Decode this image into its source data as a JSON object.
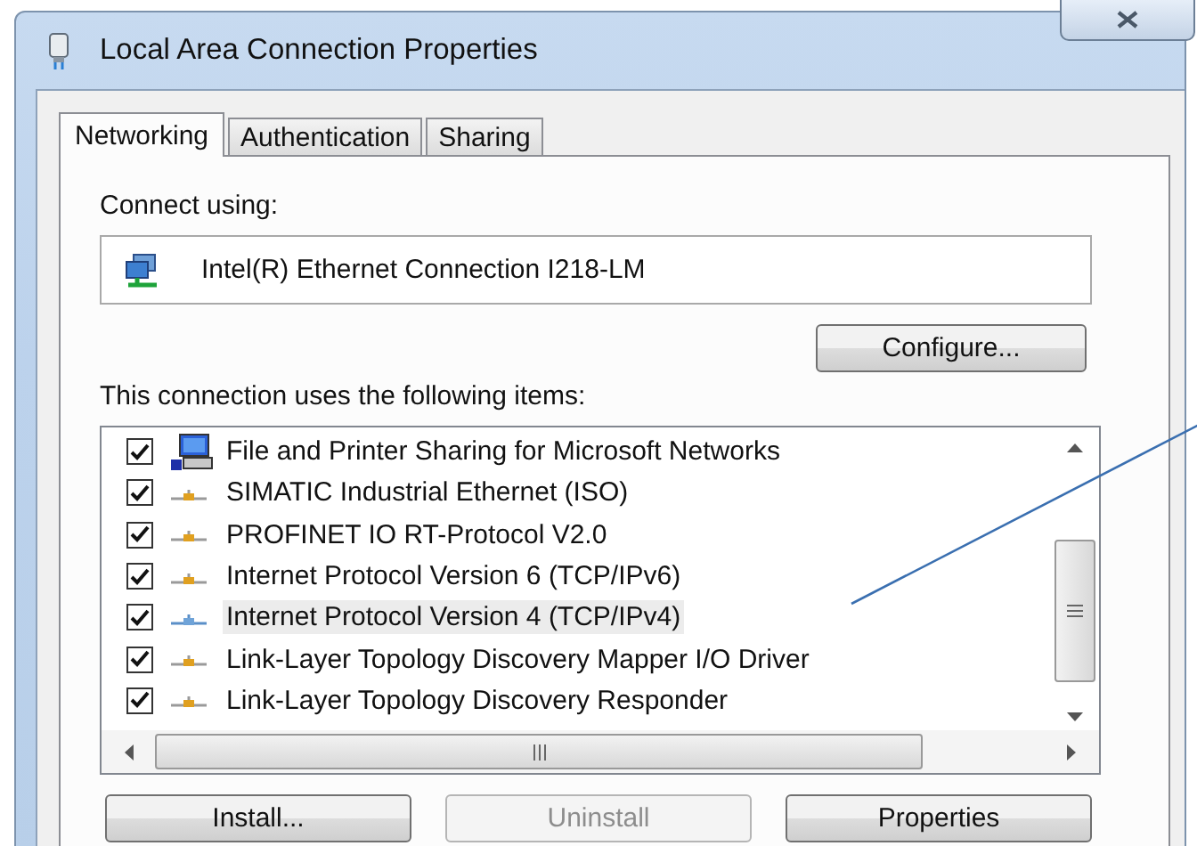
{
  "window": {
    "title": "Local Area Connection Properties"
  },
  "tabs": [
    {
      "label": "Networking",
      "selected": true
    },
    {
      "label": "Authentication",
      "selected": false
    },
    {
      "label": "Sharing",
      "selected": false
    }
  ],
  "connect_using": {
    "label": "Connect using:",
    "adapter": "Intel(R) Ethernet Connection I218-LM",
    "configure_button": "Configure..."
  },
  "items_label": "This connection uses the following items:",
  "items": [
    {
      "kind": "service",
      "label": "File and Printer Sharing for Microsoft Networks",
      "checked": true,
      "selected": false
    },
    {
      "kind": "protocol",
      "label": "SIMATIC Industrial Ethernet (ISO)",
      "checked": true,
      "selected": false
    },
    {
      "kind": "protocol",
      "label": "PROFINET IO RT-Protocol V2.0",
      "checked": true,
      "selected": false
    },
    {
      "kind": "protocol",
      "label": "Internet Protocol Version 6 (TCP/IPv6)",
      "checked": true,
      "selected": false
    },
    {
      "kind": "protocol",
      "label": "Internet Protocol Version 4 (TCP/IPv4)",
      "checked": true,
      "selected": true
    },
    {
      "kind": "protocol",
      "label": "Link-Layer Topology Discovery Mapper I/O Driver",
      "checked": true,
      "selected": false
    },
    {
      "kind": "protocol",
      "label": "Link-Layer Topology Discovery Responder",
      "checked": true,
      "selected": false
    }
  ],
  "buttons": [
    {
      "label": "Install...",
      "disabled": false
    },
    {
      "label": "Uninstall",
      "disabled": true
    },
    {
      "label": "Properties",
      "disabled": false
    }
  ]
}
